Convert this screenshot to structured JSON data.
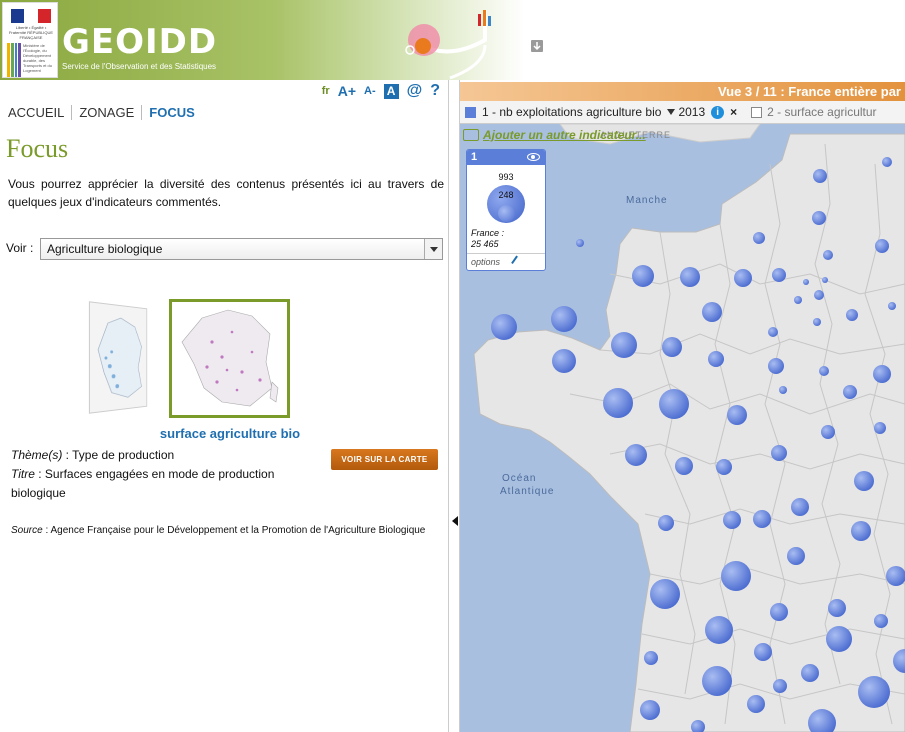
{
  "header": {
    "brand": "GEOIDD",
    "subtitle": "Service de l'Observation et des Statistiques",
    "logo_rf": "Liberté • Égalité • Fraternité RÉPUBLIQUE FRANÇAISE",
    "logo_ministry": "Ministère de l'Écologie, du Développement durable, des Transports et du Logement"
  },
  "toolbar": {
    "lang": "fr",
    "font_increase": "A+",
    "font_decrease": "A-",
    "contrast": "A",
    "contact": "@",
    "help": "?"
  },
  "breadcrumb": [
    "ACCUEIL",
    "ZONAGE",
    "FOCUS"
  ],
  "page": {
    "title": "Focus",
    "intro": "Vous pourrez apprécier la diversité des contenus présentés ici au travers de quelques jeux d'indicateurs commentés.",
    "voir_label": "Voir :",
    "voir_value": "Agriculture biologique"
  },
  "focus_item": {
    "caption": "surface agriculture bio",
    "theme_label": "Thème(s)",
    "theme_value": " : Type de production",
    "titre_label": "Titre",
    "titre_value": " : Surfaces engagées en mode de production biologique",
    "button": "VOIR SUR LA CARTE",
    "source_label": "Source",
    "source_value": " : Agence Française pour le Développement et la Promotion de l'Agriculture Biologique"
  },
  "map": {
    "view_header": "Vue 3 / 11 : France entière par",
    "indicator1": "1 - nb exploitations agriculture bio",
    "year": "2013",
    "info": "i",
    "remove": "×",
    "indicator2": "2 - surface agricultur",
    "add_indicator": "Ajouter un autre indicateur...",
    "legend": {
      "number": "1",
      "max": "993",
      "mid": "248",
      "france_label": "France :",
      "france_value": "25 465",
      "options": "options"
    },
    "sea_manche": "Manche",
    "sea_ocean": "Océan",
    "sea_atlantique": "Atlantique",
    "angleterre": "ANGLETERRE"
  },
  "colors": {
    "accent_green": "#7a9a2a",
    "link_blue": "#1f6fb0",
    "bubble_blue": "#5b7fd8",
    "button_orange": "#c8681a"
  }
}
